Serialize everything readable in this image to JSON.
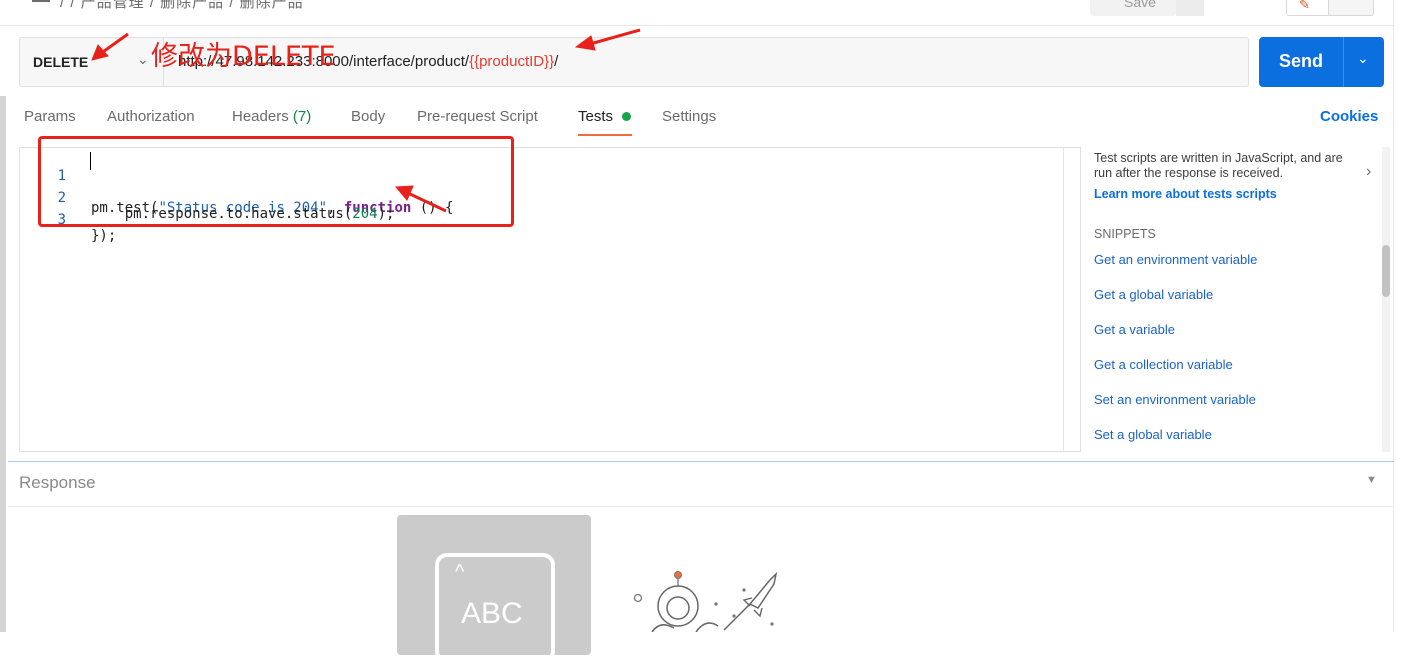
{
  "topbar": {
    "breadcrumb": "/ / 产品管理 / 删除产品 / 删除产品",
    "save_label": "Save"
  },
  "request": {
    "method": "DELETE",
    "url_prefix": "http://47.98.142.233:8000/interface/product/",
    "url_variable": "{{productID}}",
    "url_suffix": "/",
    "send_label": "Send"
  },
  "tabs": [
    {
      "label": "Params"
    },
    {
      "label": "Authorization"
    },
    {
      "label": "Headers",
      "count": "(7)"
    },
    {
      "label": "Body"
    },
    {
      "label": "Pre-request Script"
    },
    {
      "label": "Tests",
      "active": true
    },
    {
      "label": "Settings"
    }
  ],
  "cookies_label": "Cookies",
  "editor": {
    "lines": [
      {
        "n": "1",
        "t1": "pm.test(",
        "s": "\"Status code is 204\"",
        "t2": ", ",
        "kw": "function",
        "t3": " () {"
      },
      {
        "n": "2",
        "t1": "    pm.response.to.have.status(",
        "num": "204",
        "t2": ");"
      },
      {
        "n": "3",
        "t1": "});"
      }
    ]
  },
  "side": {
    "description": "Test scripts are written in JavaScript, and are run after the response is received.",
    "learn_more": "Learn more about tests scripts",
    "snippets_heading": "SNIPPETS",
    "snippets": [
      "Get an environment variable",
      "Get a global variable",
      "Get a variable",
      "Get a collection variable",
      "Set an environment variable",
      "Set a global variable"
    ]
  },
  "response": {
    "title": "Response",
    "illustration_text": "ABC"
  },
  "annotation": {
    "text": "修改为DELETE",
    "color": "#e8221a"
  },
  "colors": {
    "send": "#0b6fe0",
    "active_tab_underline": "#f26b3a",
    "tests_dot": "#15a54a"
  }
}
